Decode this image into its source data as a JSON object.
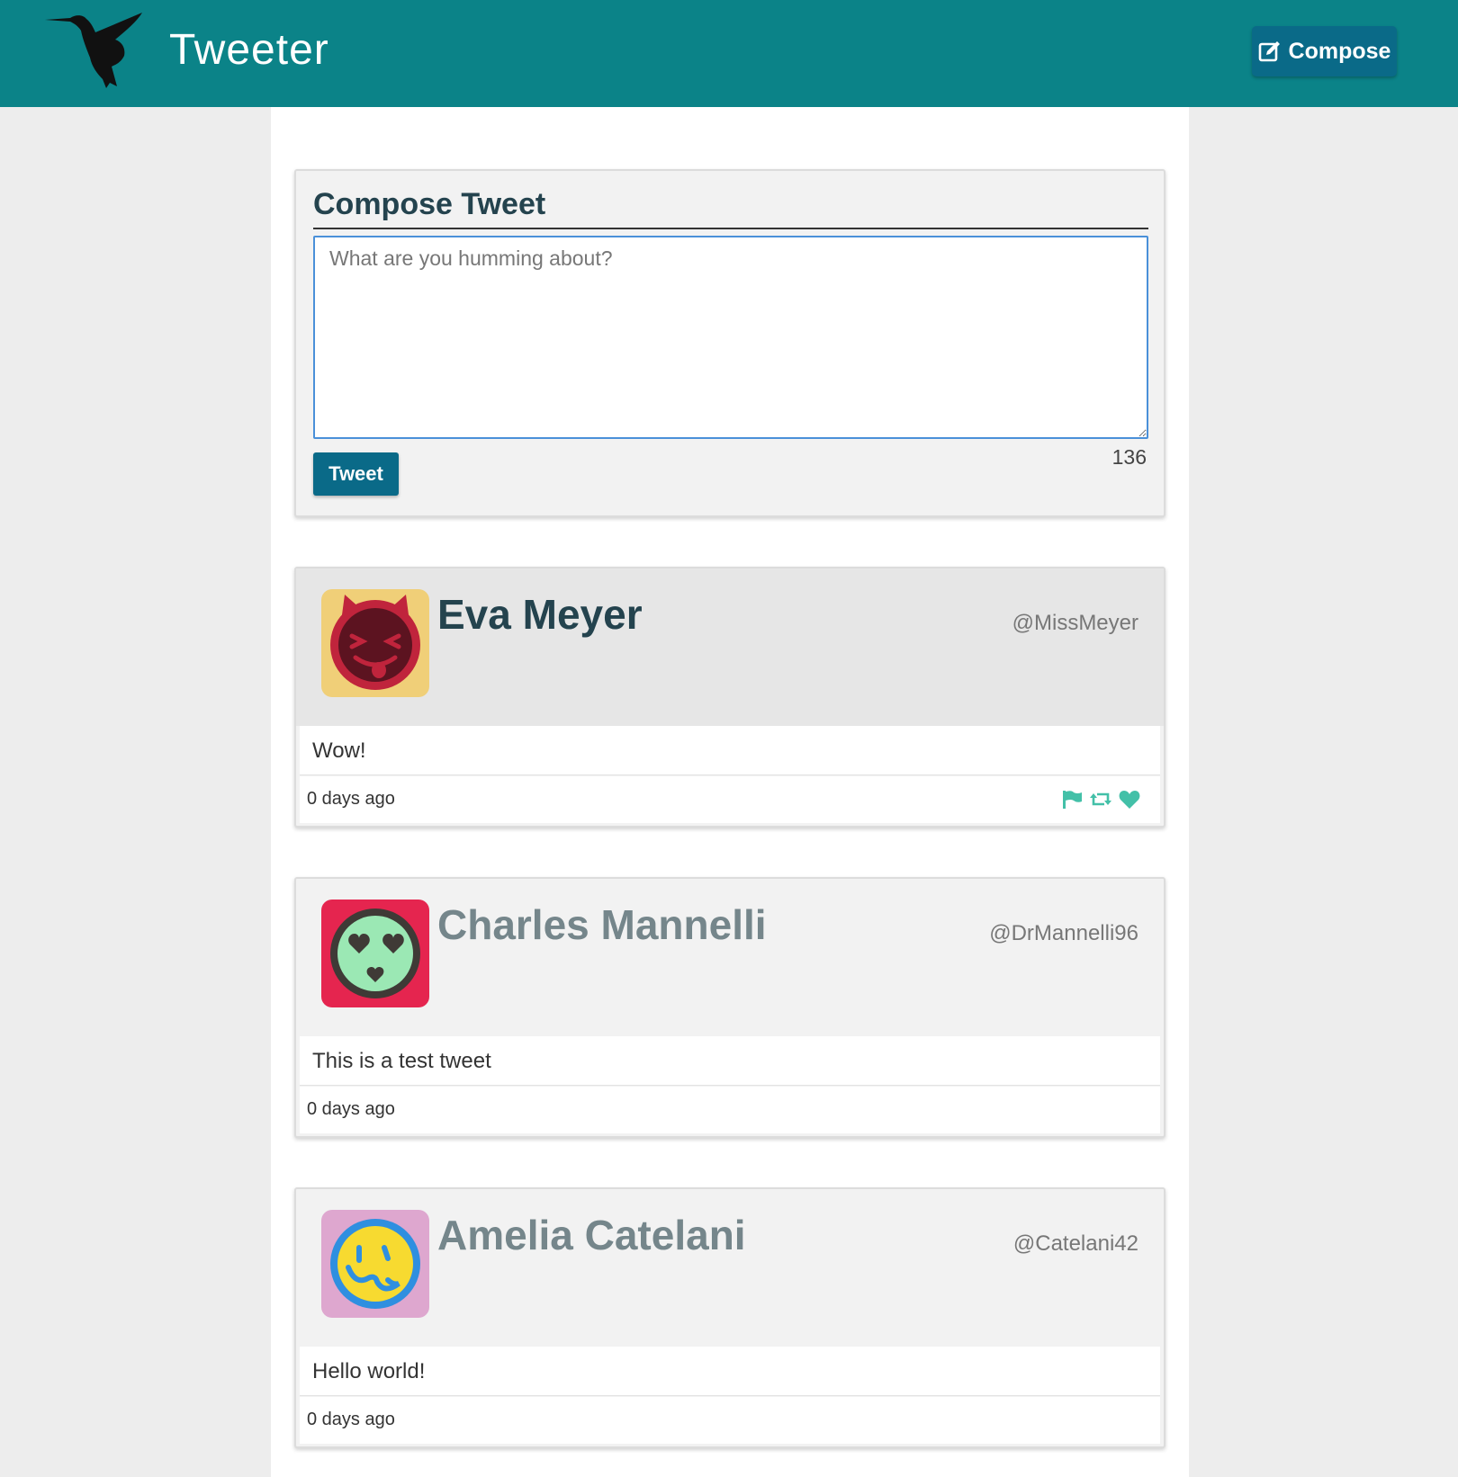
{
  "nav": {
    "brand": "Tweeter",
    "compose_label": "Compose",
    "colors": {
      "bar": "#0b8388",
      "button": "#0a6a88"
    }
  },
  "compose": {
    "title": "Compose Tweet",
    "placeholder": "What are you humming about?",
    "submit_label": "Tweet",
    "counter": "136"
  },
  "tweets": [
    {
      "name": "Eva Meyer",
      "handle": "@MissMeyer",
      "text": "Wow!",
      "time": "0 days ago",
      "avatar": {
        "icon": "devil-face-icon",
        "bg": "#f0cf78",
        "face": "#c0243c"
      }
    },
    {
      "name": "Charles Mannelli",
      "handle": "@DrMannelli96",
      "text": "This is a test tweet",
      "time": "0 days ago",
      "avatar": {
        "icon": "heart-eyes-face-icon",
        "bg": "#e5254f",
        "face": "#9be8b4"
      }
    },
    {
      "name": "Amelia Catelani",
      "handle": "@Catelani42",
      "text": "Hello world!",
      "time": "0 days ago",
      "avatar": {
        "icon": "mustache-face-icon",
        "bg": "#dea7cf",
        "face": "#f7da30"
      }
    }
  ],
  "actions": [
    "flag-icon",
    "retweet-icon",
    "heart-icon"
  ]
}
